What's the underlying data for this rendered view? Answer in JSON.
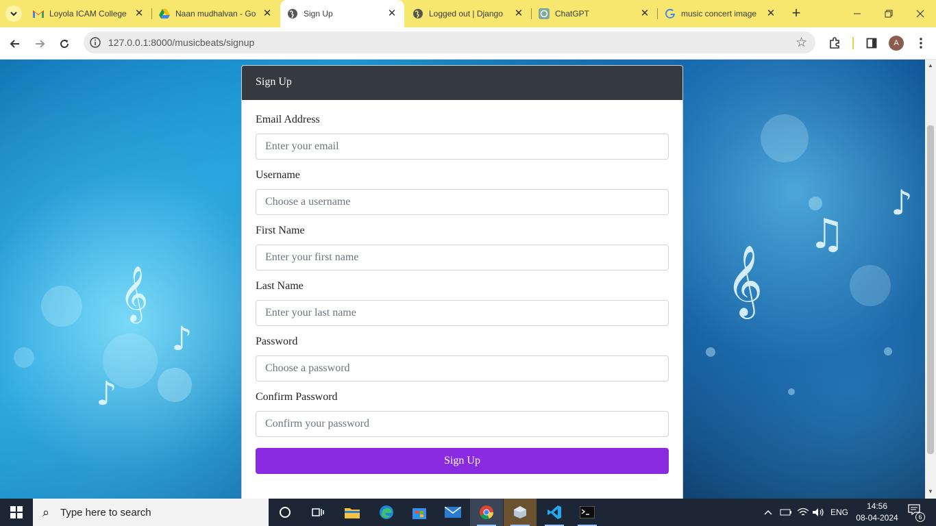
{
  "browser": {
    "tabs": [
      {
        "title": "Loyola ICAM College",
        "icon": "gmail-icon"
      },
      {
        "title": "Naan mudhalvan - Go",
        "icon": "google-drive-icon"
      },
      {
        "title": "Sign Up",
        "icon": "globe-icon"
      },
      {
        "title": "Logged out | Django",
        "icon": "globe-icon"
      },
      {
        "title": "ChatGPT",
        "icon": "chatgpt-icon"
      },
      {
        "title": "music concert image",
        "icon": "google-icon"
      }
    ],
    "active_tab_index": 2,
    "url": "127.0.0.1:8000/musicbeats/signup",
    "profile_initial": "A",
    "chrome_color": "#f7e76e"
  },
  "form": {
    "header": "Sign Up",
    "fields": [
      {
        "label": "Email Address",
        "placeholder": "Enter your email"
      },
      {
        "label": "Username",
        "placeholder": "Choose a username"
      },
      {
        "label": "First Name",
        "placeholder": "Enter your first name"
      },
      {
        "label": "Last Name",
        "placeholder": "Enter your last name"
      },
      {
        "label": "Password",
        "placeholder": "Choose a password"
      },
      {
        "label": "Confirm Password",
        "placeholder": "Confirm your password"
      }
    ],
    "submit_label": "Sign Up",
    "header_color": "#343a40",
    "button_color": "#8a2be2"
  },
  "taskbar": {
    "search_placeholder": "Type here to search",
    "language": "ENG",
    "time": "14:56",
    "date": "08-04-2024",
    "notification_count": "6",
    "pinned": [
      "cortana-icon",
      "task-view-icon",
      "file-explorer-icon",
      "edge-icon",
      "store-icon",
      "mail-icon",
      "chrome-icon",
      "app-icon",
      "vscode-icon",
      "terminal-icon"
    ]
  }
}
